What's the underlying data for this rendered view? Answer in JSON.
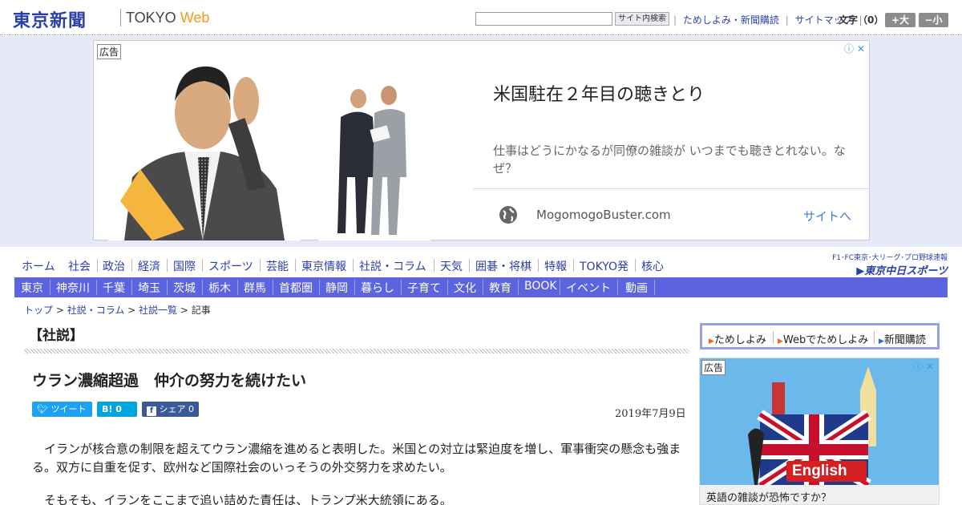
{
  "header": {
    "logo_ja": "東京新聞",
    "logo_en_main": "TOKYO ",
    "logo_en_accent": "Web",
    "search_button": "サイト内検索",
    "links": [
      "ためしよみ・新聞購読",
      "サイトマップ"
    ],
    "font_size_label": "文字（0）",
    "font_larger": "+大",
    "font_smaller": "−小"
  },
  "top_ad": {
    "label": "広告",
    "choices": "ⓘ ✕",
    "headline": "米国駐在２年目の聴きとり",
    "description": "仕事はどうにかなるが同僚の雑談が いつまでも聴きとれない。なぜ？",
    "domain": "MogomogoBuster.com",
    "cta": "サイトへ"
  },
  "nav_main": [
    "ホーム",
    "社会",
    "政治",
    "経済",
    "国際",
    "スポーツ",
    "芸能",
    "東京情報",
    "社説・コラム",
    "天気",
    "囲碁・将棋",
    "特報",
    "TOKYO発",
    "核心"
  ],
  "chunichi": {
    "line1": "F1･FC東京･大リーグ･プロ野球速報",
    "line2": "▶東京中日スポーツ"
  },
  "nav_region": [
    "東京",
    "神奈川",
    "千葉",
    "埼玉",
    "茨城",
    "栃木",
    "群馬",
    "首都圏",
    "静岡",
    "暮らし",
    "子育て",
    "文化",
    "教育",
    "BOOK",
    "イベント",
    "動画"
  ],
  "breadcrumb": {
    "items": [
      "トップ",
      "社説・コラム",
      "社説一覧"
    ],
    "current": "記事",
    "sep": " > "
  },
  "article": {
    "section": "【社説】",
    "title": "ウラン濃縮超過　仲介の努力を続けたい",
    "date": "2019年7月9日",
    "share": {
      "tweet": "ツイート",
      "hatena_count": "0",
      "fb_label": "シェア",
      "fb_count": "0"
    },
    "paragraphs": [
      "　イランが核合意の制限を超えてウラン濃縮を進めると表明した。米国との対立は緊迫度を増し、軍事衝突の懸念も強まる。双方に自重を促す、欧州など国際社会のいっそうの外交努力を求めたい。",
      "　そもそも、イランをここまで追い詰めた責任は、トランプ米大統領にある。"
    ]
  },
  "side": {
    "links": [
      "ためしよみ",
      "Webでためしよみ",
      "新聞購読"
    ],
    "ad_label": "広告",
    "ad_choices": "ⓘ ✕",
    "ad_image_text": "English",
    "ad_caption": "英語の雑談が恐怖ですか？"
  },
  "colors": {
    "brand_blue": "#2b3fa8",
    "nav_bar": "#5b63e0",
    "ad_band": "#e6e9f8",
    "twitter": "#1da1f2",
    "hatena": "#00a4de",
    "facebook": "#3b5998"
  }
}
